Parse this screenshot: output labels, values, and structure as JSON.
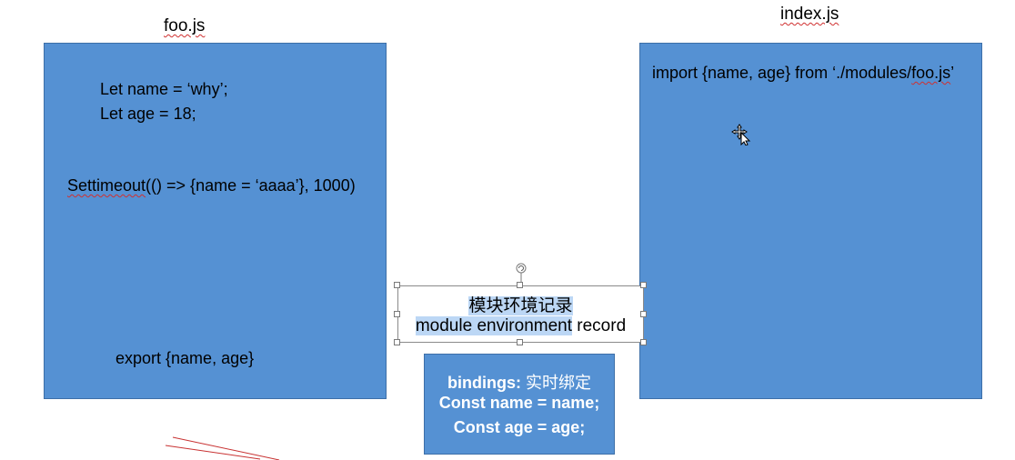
{
  "foo_title": "foo.js",
  "index_title": "index.js",
  "foo_panel": {
    "line1": "Let name = ‘why’;",
    "line2": "Let age = 18;",
    "timeout_word": "Settimeout",
    "timeout_rest": "(() => {name = ‘aaaa’}, 1000)",
    "export_line": "export {name, age}"
  },
  "index_panel": {
    "import_before": "import {name, age} from ‘./modules/",
    "import_file": "foo.js",
    "import_after": "’"
  },
  "env_record": {
    "title_cn": "模块环境记录",
    "title_en_highlighted": "module environment",
    "title_en_rest": " record"
  },
  "bindings": {
    "label": "bindings:",
    "label_cn": " 实时绑定",
    "line1": "Const name = name;",
    "line2": "Const age = age;"
  },
  "colors": {
    "panel_fill": "#5591d3",
    "selection_highlight": "#bcd7f5",
    "pen_stroke": "#c83232"
  },
  "icons": {
    "cursor": "move-cursor-icon",
    "rotate": "rotate-handle-icon"
  }
}
